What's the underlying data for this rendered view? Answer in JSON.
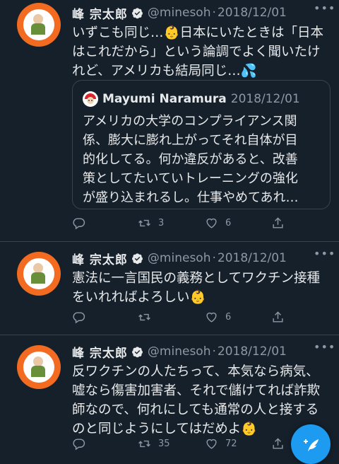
{
  "tweets": [
    {
      "name": "峰 宗太郎",
      "handle": "@minesoh",
      "dot": "·",
      "date": "2018/12/01",
      "text": "いずこも同じ…👶日本にいたときは「日本\nはこれだから」という論調でよく聞いたけ\nれど、アメリカも結局同じ…💦",
      "quote": {
        "name": "Mayumi Naramura",
        "date": "2018/12/01",
        "text": "アメリカの大学のコンプライアンス関\n係、膨大に膨れ上がってそれ自体が目\n的化してる。何か違反があると、改善\n策としてたいていトレーニングの強化\nが盛り込まれるし。仕事やめてあれ…"
      },
      "reply_count": "",
      "retweet_count": "3",
      "like_count": "6"
    },
    {
      "name": "峰 宗太郎",
      "handle": "@minesoh",
      "dot": "·",
      "date": "2018/12/01",
      "text": "憲法に一言国民の義務としてワクチン接種\nをいれればよろしい👶",
      "reply_count": "",
      "retweet_count": "",
      "like_count": "6"
    },
    {
      "name": "峰 宗太郎",
      "handle": "@minesoh",
      "dot": "·",
      "date": "2018/12/01",
      "text": "反ワクチンの人たちって、本気なら病気、\n嘘なら傷害加害者、それで儲けてれば詐欺\n師なので、何れにしても通常の人と接する\nのと同じようにしてはだめよ👶",
      "reply_count": "",
      "retweet_count": "35",
      "like_count": "72"
    }
  ],
  "colors": {
    "background": "#15202b",
    "text": "#e7e9ea",
    "secondary": "#8b98a5",
    "border": "#38444d",
    "accent": "#1d9bf0",
    "avatar_orange": "#f26b21"
  },
  "icons": {
    "verified": "verified-badge-icon",
    "more": "more-icon",
    "reply": "reply-icon",
    "retweet": "retweet-icon",
    "like": "heart-icon",
    "share": "share-icon",
    "compose": "compose-tweet-icon"
  }
}
